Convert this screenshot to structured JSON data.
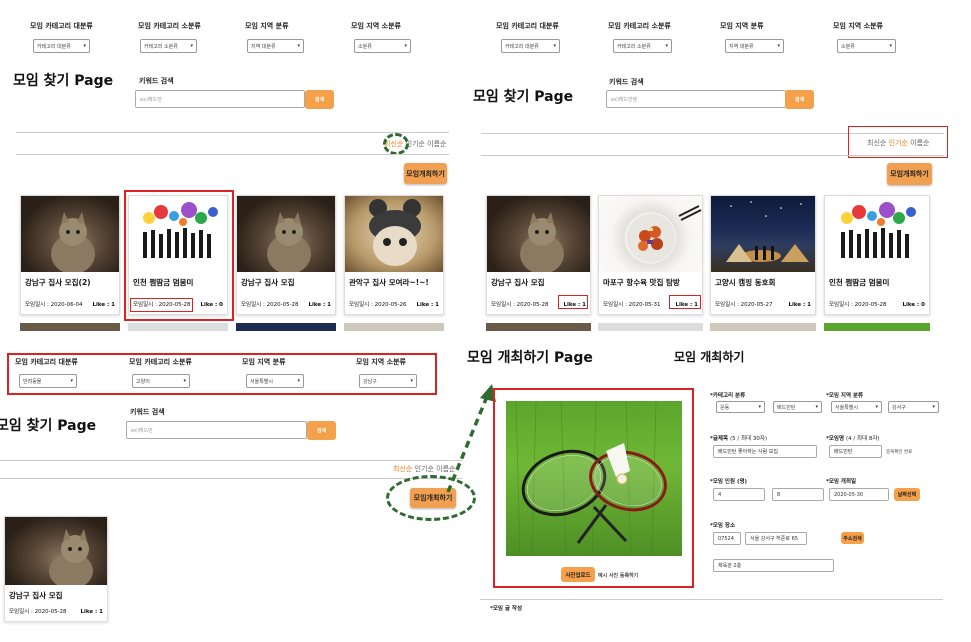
{
  "top_left": {
    "filters": [
      {
        "label": "모임 카테고리 대분류",
        "value": "카테고리 대분류"
      },
      {
        "label": "모임 카테고리 소분류",
        "value": "카테고리 소분류"
      },
      {
        "label": "모임 지역 분류",
        "value": "지역 대분류"
      },
      {
        "label": "모임 지역 소분류",
        "value": "소분류"
      }
    ],
    "page_title": "모임 찾기 Page",
    "keyword_label": "키워드 검색",
    "keyword_placeholder": "ex)헤드만",
    "search_label": "검색",
    "sort": {
      "latest": "최신순",
      "popular": "인기순",
      "name": "이름순"
    },
    "create_label": "모임개최하기",
    "cards": [
      {
        "title": "강남구 집사 모집(2)",
        "date": "모임일시 : 2020-06-04",
        "like": "Like : 1"
      },
      {
        "title": "인천 쩜땀금 멈뭄미",
        "date": "모임일시 : 2020-05-28",
        "like": "Like : 0"
      },
      {
        "title": "강남구 집사 모집",
        "date": "모임일시 : 2020-05-28",
        "like": "Like : 1"
      },
      {
        "title": "관악구 집사 모여라~!~!",
        "date": "모임일시 : 2020-05-26",
        "like": "Like : 1"
      }
    ]
  },
  "top_right": {
    "filters": [
      {
        "label": "모임 카테고리 대분류",
        "value": "카테고리 대분류"
      },
      {
        "label": "모임 카테고리 소분류",
        "value": "카테고리 소분류"
      },
      {
        "label": "모임 지역 분류",
        "value": "지역 대분류"
      },
      {
        "label": "모임 지역 소분류",
        "value": "소분류"
      }
    ],
    "page_title": "모임 찾기 Page",
    "keyword_label": "키워드 검색",
    "keyword_placeholder": "ex)헤드만텐",
    "search_label": "검색",
    "sort": {
      "latest": "최신순",
      "popular": "인기순",
      "name": "이름순"
    },
    "create_label": "모임개최하기",
    "cards": [
      {
        "title": "강남구 집사 모집",
        "date": "모임일시 : 2020-05-28",
        "like": "Like : 1"
      },
      {
        "title": "마포구 항수육 맛집 탐방",
        "date": "모임일시 : 2020-05-31",
        "like": "Like : 1"
      },
      {
        "title": "고양시 캠핑 동호회",
        "date": "모임일시 : 2020-05-27",
        "like": "Like : 1"
      },
      {
        "title": "인천 쩜땀금 멈뭄미",
        "date": "모임일시 : 2020-05-28",
        "like": "Like : 0"
      }
    ]
  },
  "bottom_left": {
    "filters": [
      {
        "label": "모임 카테고리 대분류",
        "value": "반려동물"
      },
      {
        "label": "모임 카테고리 소분류",
        "value": "고양이"
      },
      {
        "label": "모임 지역 분류",
        "value": "서울특별시"
      },
      {
        "label": "모임 지역 소분류",
        "value": "강남구"
      }
    ],
    "page_title": "모임 찾기 Page",
    "keyword_label": "키워드 검색",
    "keyword_placeholder": "ex)헤드만",
    "search_label": "검색",
    "sort": {
      "latest": "최신순",
      "popular": "인기순",
      "name": "이름순"
    },
    "create_label": "모임개최하기",
    "card": {
      "title": "강남구 집사 모집",
      "date": "모임일시 : 2020-05-28",
      "like": "Like : 1"
    }
  },
  "bottom_right": {
    "page_title": "모임 개최하기 Page",
    "form_title": "모임 개최하기",
    "upload_label": "사진업로드",
    "upload_note": "예시 사진 등록하기",
    "category_label": "*카테고리 분류",
    "category_values": [
      "운동",
      "배드민턴"
    ],
    "region_label": "*모임 지역 분류",
    "region_values": [
      "서울특별시",
      "강서구"
    ],
    "subject_label": "*글제목",
    "subject_hint": "(5 / 최대 30자)",
    "subject_value": "배드민턴 좋아하는 사람 모집",
    "meetname_label": "*모임명",
    "meetname_hint": "(4 / 최대 8자)",
    "meetname_value": "배드민턴",
    "meetname_check": "중복확인 완료",
    "members_label": "*모임 인원 (명)",
    "members_min": "4",
    "members_max": "8",
    "date_label": "*모임 개최일",
    "date_value": "2020-05-30",
    "date_button": "날짜선택",
    "place_label": "*모임 장소",
    "zipcode": "07524",
    "address": "서울 강서구 허준로 65",
    "address_button": "주소검색",
    "address_detail": "체육관 2층",
    "content_label": "*모임 글 작성"
  }
}
